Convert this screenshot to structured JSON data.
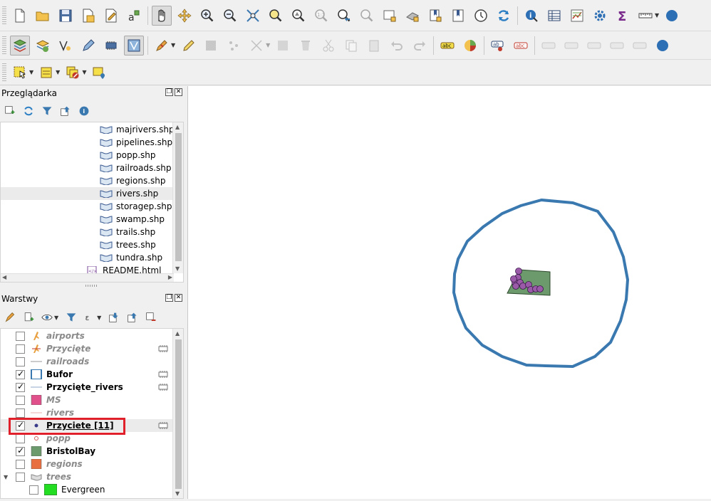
{
  "browser_panel": {
    "title": "Przeglądarka",
    "items": [
      {
        "label": "majrivers.shp"
      },
      {
        "label": "pipelines.shp"
      },
      {
        "label": "popp.shp"
      },
      {
        "label": "railroads.shp"
      },
      {
        "label": "regions.shp"
      },
      {
        "label": "rivers.shp"
      },
      {
        "label": "storagep.shp"
      },
      {
        "label": "swamp.shp"
      },
      {
        "label": "trails.shp"
      },
      {
        "label": "trees.shp"
      },
      {
        "label": "tundra.shp"
      },
      {
        "label": "README.html"
      }
    ]
  },
  "layers_panel": {
    "title": "Warstwy",
    "layers": [
      {
        "label": "airports",
        "checked": false,
        "visible": false
      },
      {
        "label": "Przycięte",
        "checked": false,
        "visible": false
      },
      {
        "label": "railroads",
        "checked": false,
        "visible": false
      },
      {
        "label": "Bufor",
        "checked": true,
        "visible": true
      },
      {
        "label": "Przycięte_rivers",
        "checked": true,
        "visible": true
      },
      {
        "label": "MS",
        "checked": false,
        "visible": false
      },
      {
        "label": "rivers",
        "checked": false,
        "visible": false
      },
      {
        "label": "Przyciete [11]",
        "checked": true,
        "visible": true
      },
      {
        "label": "popp",
        "checked": false,
        "visible": false
      },
      {
        "label": "BristolBay",
        "checked": true,
        "visible": true
      },
      {
        "label": "regions",
        "checked": false,
        "visible": false
      },
      {
        "label": "trees",
        "checked": false,
        "visible": false
      },
      {
        "label": "Evergreen",
        "checked": false,
        "visible": true
      }
    ]
  },
  "colors": {
    "buffer_stroke": "#3a78b0",
    "polygon_fill": "#6c9a6c",
    "point_fill": "#9a5aa8",
    "highlight": "#e0202a",
    "ms_fill": "#e0508a",
    "bristol_fill": "#6c9a6c",
    "regions_fill": "#e87040",
    "evergreen_fill": "#22dd22"
  }
}
